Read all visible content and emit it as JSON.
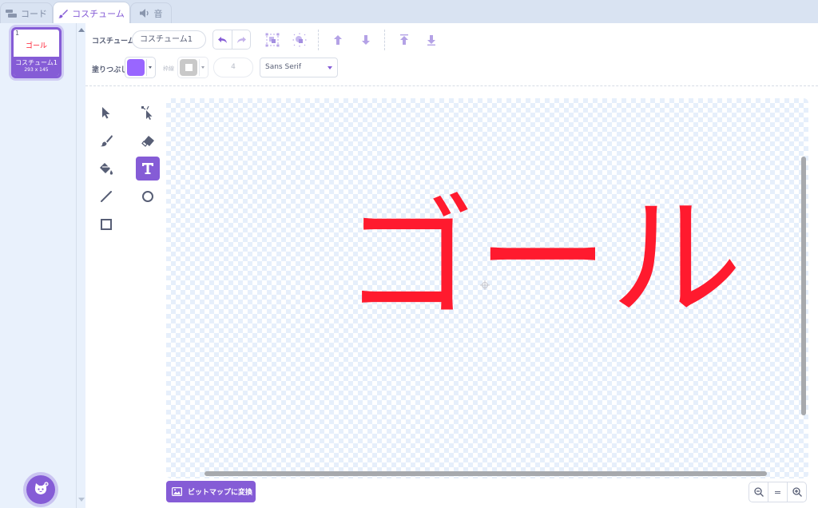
{
  "tabs": [
    {
      "label": "コード",
      "icon": "code-blocks-icon"
    },
    {
      "label": "コスチューム",
      "icon": "paintbrush-icon"
    },
    {
      "label": "音",
      "icon": "speaker-icon"
    }
  ],
  "costume_list": {
    "items": [
      {
        "number": "1",
        "thumbnail_text": "ゴール",
        "name": "コスチューム1",
        "size": "293 x 145"
      }
    ]
  },
  "toolbar": {
    "costume_label": "コスチューム",
    "costume_name": "コスチューム1",
    "fill_label": "塗りつぶし",
    "fill_color": "#9966ff",
    "outline_label": "枠線",
    "outline_color": "#a6a6a6",
    "outline_width": "4",
    "font": "Sans Serif"
  },
  "canvas": {
    "text": "ゴール",
    "text_color": "#ff1a2e"
  },
  "bottom": {
    "convert_label": "ビットマップに変換",
    "zoom_reset": "="
  },
  "colors": {
    "accent": "#855cd6",
    "tab_bar": "#d9e3f2",
    "sidebar": "#e9f1fc"
  }
}
